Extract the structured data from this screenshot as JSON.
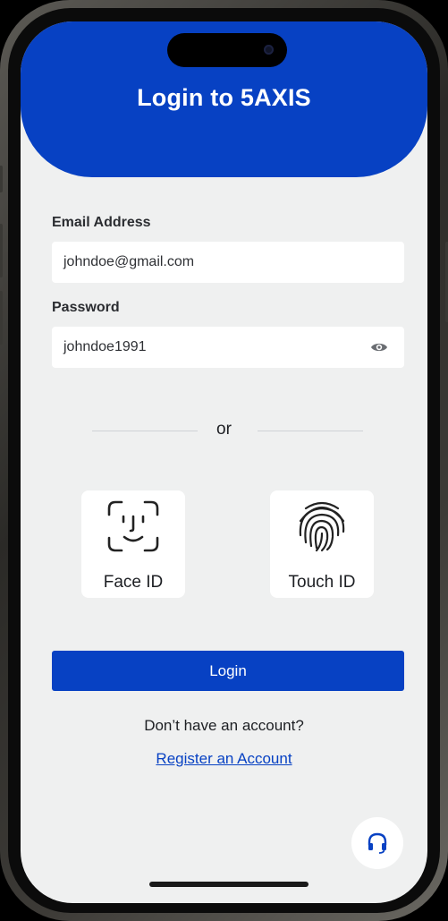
{
  "header": {
    "title": "Login to 5AXIS"
  },
  "form": {
    "email_label": "Email Address",
    "email_value": "johndoe@gmail.com",
    "password_label": "Password",
    "password_value": "johndoe1991",
    "password_toggle_icon": "eye-icon"
  },
  "divider": {
    "text": "or"
  },
  "biometrics": [
    {
      "label": "Face ID",
      "icon": "face-id-icon"
    },
    {
      "label": "Touch ID",
      "icon": "fingerprint-icon"
    }
  ],
  "actions": {
    "login_label": "Login",
    "no_account_text": "Don’t have an account?",
    "register_link": "Register an Account",
    "support_icon": "headset-icon"
  },
  "colors": {
    "primary": "#0741c3",
    "background": "#eff0f0",
    "card": "#ffffff"
  }
}
